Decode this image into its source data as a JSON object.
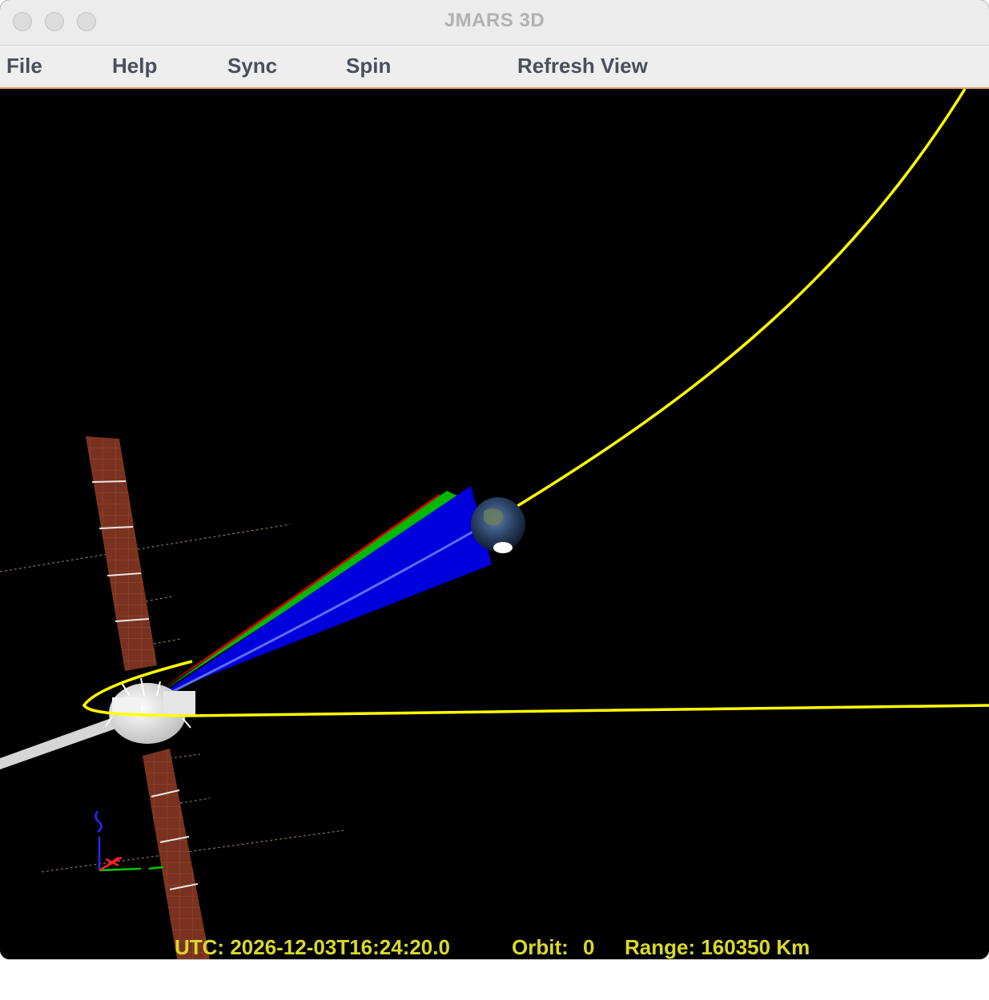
{
  "window": {
    "title": "JMARS 3D"
  },
  "menu": {
    "items": [
      {
        "label": "File"
      },
      {
        "label": "Help"
      },
      {
        "label": "Sync"
      },
      {
        "label": "Spin"
      },
      {
        "label": "Refresh View"
      }
    ]
  },
  "status": {
    "utc": "UTC: 2026-12-03T16:24:20.0",
    "orbit_label": "Orbit:",
    "orbit_value": "0",
    "range": "Range: 160350 Km"
  },
  "colors": {
    "trajectory": "#ffff00",
    "fov_red": "#d40000",
    "fov_green": "#00b800",
    "fov_blue": "#0000dd",
    "solar_panel": "#7a3220",
    "status_text": "#d9d92a"
  },
  "icons": {
    "spacecraft": "spacecraft-model",
    "planet": "earth-globe",
    "axes": "xyz-axes-gizmo"
  }
}
